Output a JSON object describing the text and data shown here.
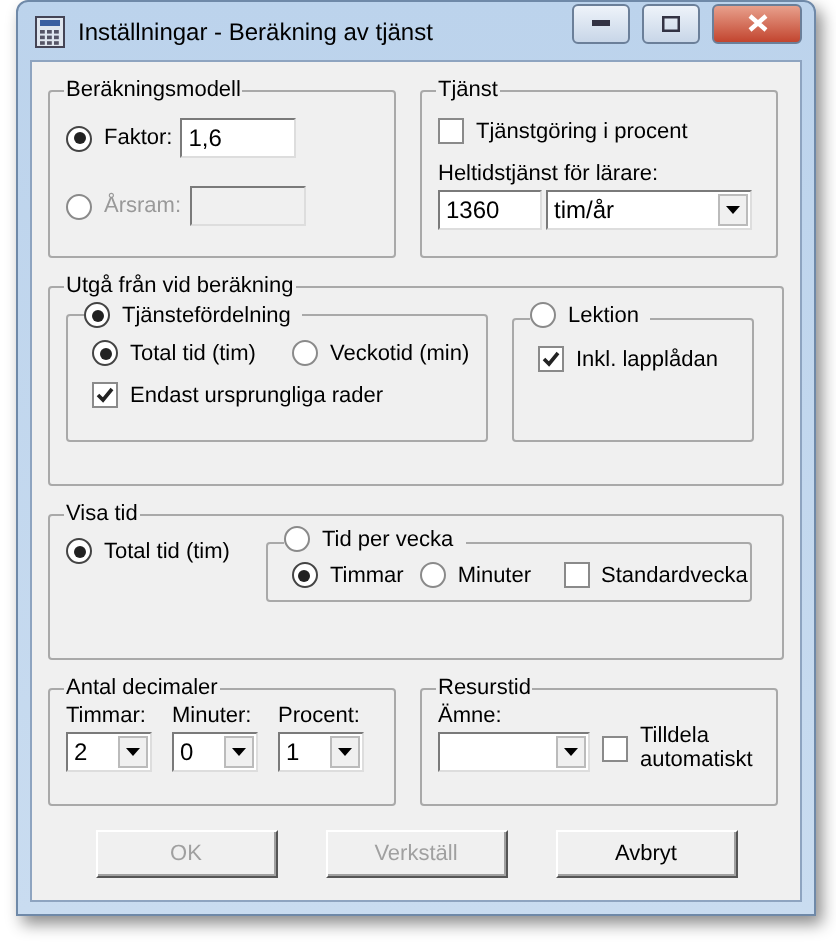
{
  "window": {
    "title": "Inställningar - Beräkning av tjänst"
  },
  "calc_model": {
    "title": "Beräkningsmodell",
    "options": [
      {
        "label": "Faktor:",
        "selected": true,
        "value": "1,6",
        "disabled": false
      },
      {
        "label": "Årsram:",
        "selected": false,
        "disabled": true
      }
    ]
  },
  "service": {
    "title": "Tjänst",
    "percent": {
      "label": "Tjänstgöring i procent",
      "checked": false
    },
    "fulltime": {
      "label": "Heltidstjänst för lärare:",
      "value": "1360",
      "unit": "tim/år"
    }
  },
  "basis": {
    "title": "Utgå från vid beräkning",
    "groups": [
      {
        "label": "Tjänstefördelning",
        "selected": true,
        "radios": [
          {
            "label": "Total tid (tim)",
            "selected": true
          },
          {
            "label": "Veckotid (min)",
            "selected": false
          }
        ],
        "checks": [
          {
            "label": "Endast ursprungliga rader",
            "checked": true
          }
        ]
      },
      {
        "label": "Lektion",
        "selected": false,
        "checks": [
          {
            "label": "Inkl. lapplådan",
            "checked": true
          }
        ]
      }
    ]
  },
  "show_time": {
    "title": "Visa tid",
    "total": {
      "label": "Total tid (tim)",
      "selected": true
    },
    "per_week": {
      "label": "Tid per vecka",
      "selected": false,
      "radios": [
        {
          "label": "Timmar",
          "selected": true
        },
        {
          "label": "Minuter",
          "selected": false
        }
      ],
      "check": {
        "label": "Standardvecka",
        "checked": false
      }
    }
  },
  "decimals": {
    "title": "Antal decimaler",
    "fields": [
      {
        "label": "Timmar:",
        "value": "2"
      },
      {
        "label": "Minuter:",
        "value": "0"
      },
      {
        "label": "Procent:",
        "value": "1"
      }
    ]
  },
  "resource": {
    "title": "Resurstid",
    "subject": {
      "label": "Ämne:"
    },
    "auto": {
      "label": "Tilldela automatiskt",
      "checked": false
    }
  },
  "buttons": [
    {
      "label": "OK",
      "disabled": true
    },
    {
      "label": "Verkställ",
      "disabled": true
    },
    {
      "label": "Avbryt",
      "disabled": false
    }
  ]
}
